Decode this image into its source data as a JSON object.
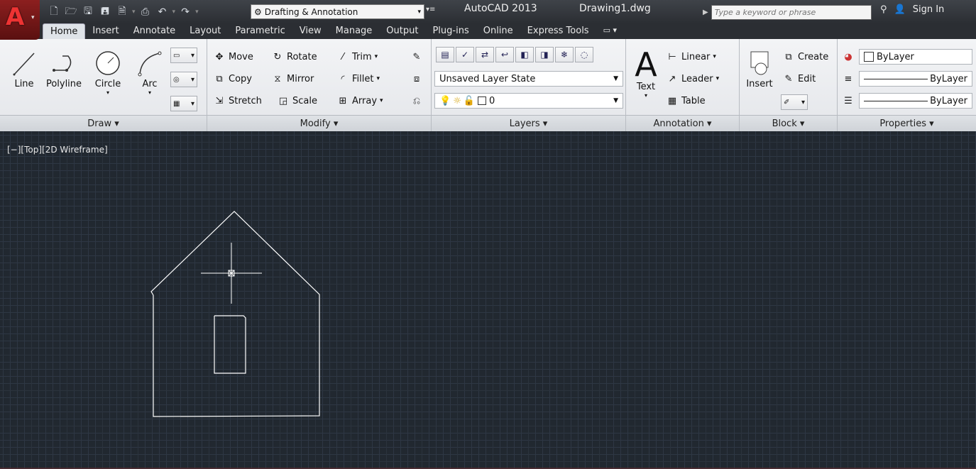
{
  "app": {
    "name": "AutoCAD 2013",
    "document": "Drawing1.dwg"
  },
  "workspace": {
    "label": "Drafting & Annotation"
  },
  "search": {
    "placeholder": "Type a keyword or phrase"
  },
  "account": {
    "sign_in": "Sign In"
  },
  "tabs": [
    "Home",
    "Insert",
    "Annotate",
    "Layout",
    "Parametric",
    "View",
    "Manage",
    "Output",
    "Plug-ins",
    "Online",
    "Express Tools"
  ],
  "panels": {
    "draw": {
      "title": "Draw ▾",
      "line": "Line",
      "polyline": "Polyline",
      "circle": "Circle",
      "arc": "Arc"
    },
    "modify": {
      "title": "Modify ▾",
      "move": "Move",
      "rotate": "Rotate",
      "trim": "Trim",
      "copy": "Copy",
      "mirror": "Mirror",
      "fillet": "Fillet",
      "stretch": "Stretch",
      "scale": "Scale",
      "array": "Array"
    },
    "layers": {
      "title": "Layers ▾",
      "layer_state": "Unsaved Layer State",
      "current_layer": "0"
    },
    "annotation": {
      "title": "Annotation ▾",
      "text": "Text",
      "linear": "Linear",
      "leader": "Leader",
      "table": "Table"
    },
    "block": {
      "title": "Block ▾",
      "insert": "Insert",
      "create": "Create",
      "edit": "Edit"
    },
    "properties": {
      "title": "Properties ▾",
      "color": "ByLayer",
      "lineweight": "ByLayer",
      "linetype": "ByLayer"
    }
  },
  "viewport": {
    "label": "[−][Top][2D Wireframe]"
  },
  "colors": {
    "canvas_bg": "#212830",
    "grid_major": "#2b333d",
    "drawing_stroke": "#ffffff",
    "app_red": "#c0262c"
  }
}
